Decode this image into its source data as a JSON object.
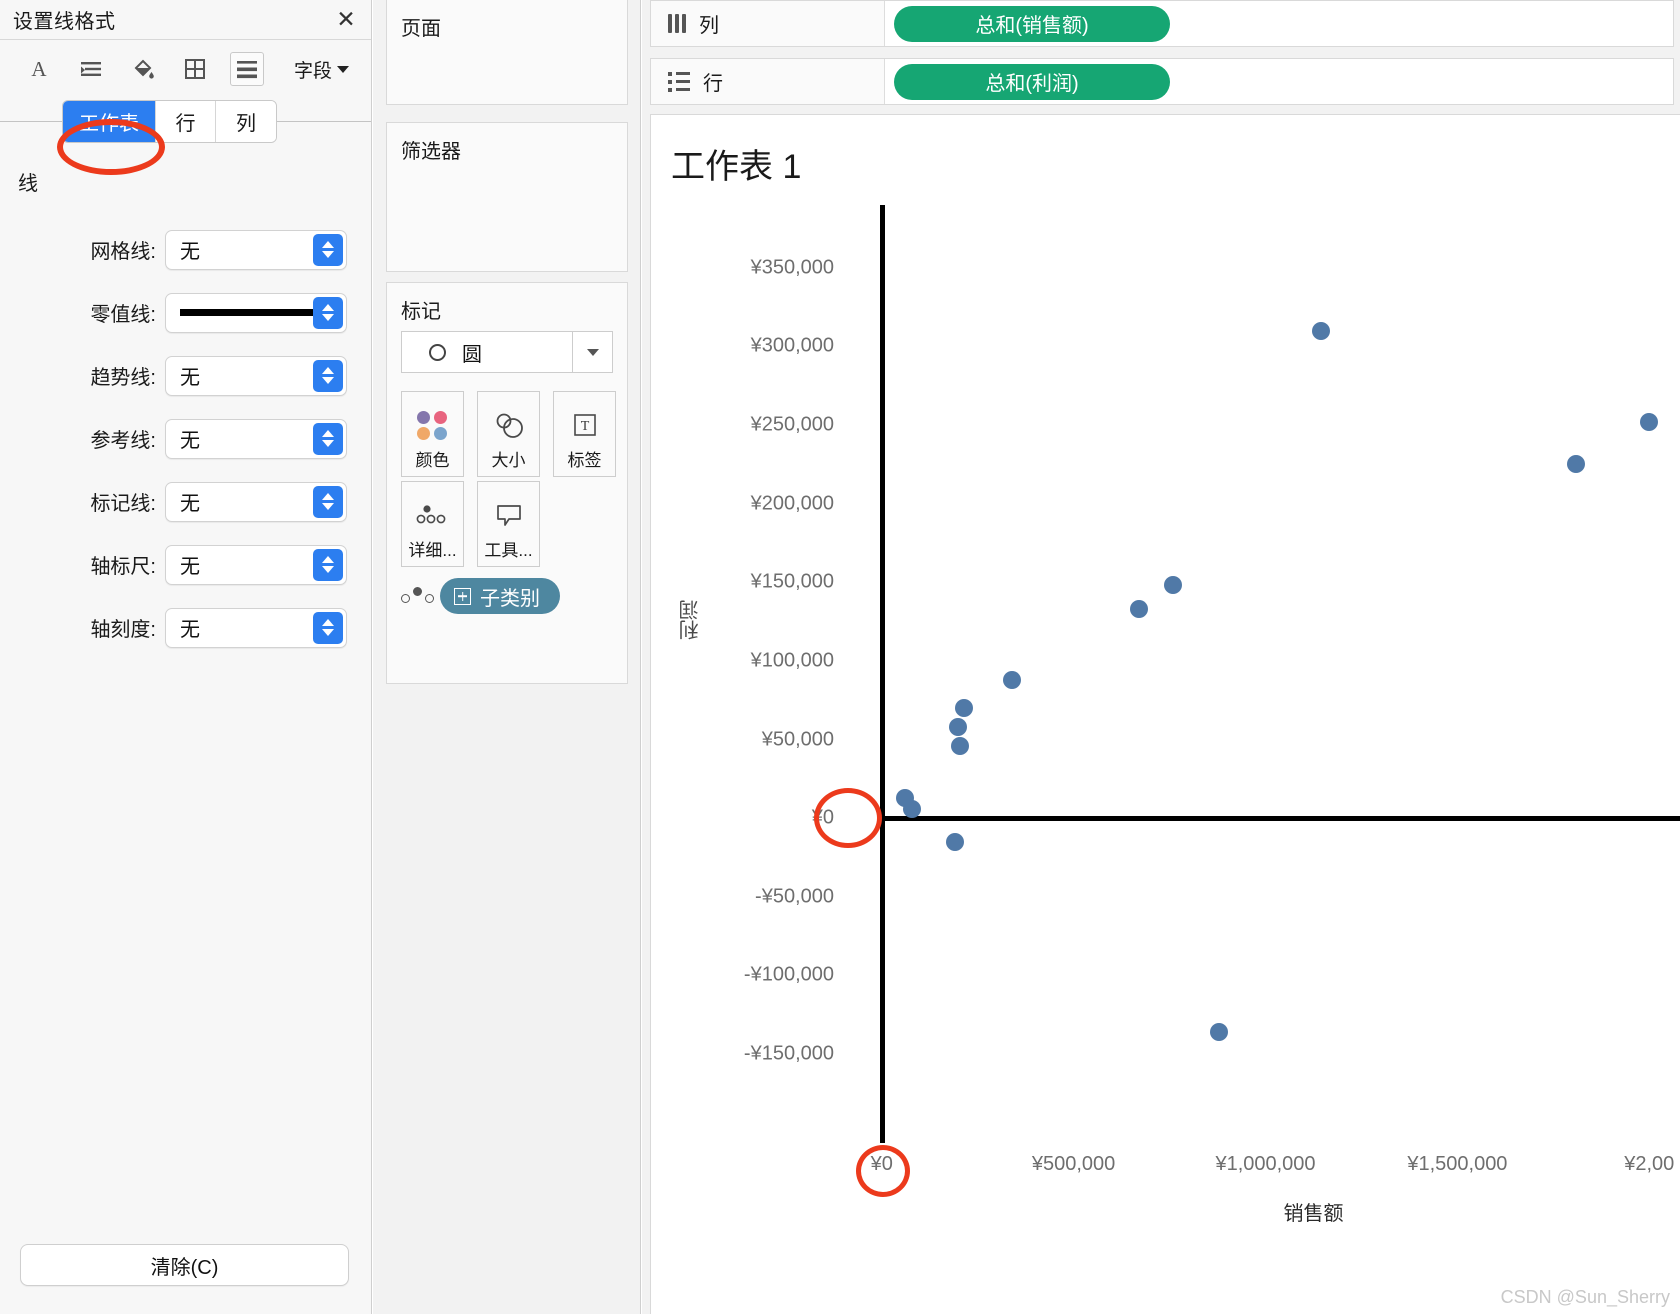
{
  "format_panel": {
    "title": "设置线格式",
    "close_icon": "close-icon",
    "toolbar": [
      {
        "icon": "font-icon",
        "glyph": "A",
        "selected": false
      },
      {
        "icon": "align-icon",
        "glyph": "",
        "selected": false
      },
      {
        "icon": "shading-icon",
        "glyph": "",
        "selected": false
      },
      {
        "icon": "borders-icon",
        "glyph": "",
        "selected": false
      },
      {
        "icon": "lines-icon",
        "glyph": "",
        "selected": true
      }
    ],
    "fields_label": "字段",
    "tabs": [
      {
        "label": "工作表",
        "active": true
      },
      {
        "label": "行",
        "active": false
      },
      {
        "label": "列",
        "active": false
      }
    ],
    "section_title": "线",
    "rows": [
      {
        "label": "网格线:",
        "value": "无",
        "type": "text"
      },
      {
        "label": "零值线:",
        "value": "",
        "type": "line"
      },
      {
        "label": "趋势线:",
        "value": "无",
        "type": "text"
      },
      {
        "label": "参考线:",
        "value": "无",
        "type": "text"
      },
      {
        "label": "标记线:",
        "value": "无",
        "type": "text"
      },
      {
        "label": "轴标尺:",
        "value": "无",
        "type": "text"
      },
      {
        "label": "轴刻度:",
        "value": "无",
        "type": "text"
      }
    ],
    "clear_label": "清除(C)"
  },
  "cards": {
    "pages": "页面",
    "filters": "筛选器",
    "marks": "标记",
    "mark_type": "圆",
    "tiles": [
      {
        "label": "颜色",
        "icon": "color-palette-icon"
      },
      {
        "label": "大小",
        "icon": "size-circles-icon"
      },
      {
        "label": "标签",
        "icon": "text-label-icon"
      },
      {
        "label": "详细...",
        "icon": "detail-dots-icon"
      },
      {
        "label": "工具...",
        "icon": "tooltip-icon"
      }
    ],
    "detail_pill": "子类别"
  },
  "shelves": {
    "columns_label": "列",
    "columns_pill": "总和(销售额)",
    "rows_label": "行",
    "rows_pill": "总和(利润)"
  },
  "view": {
    "title": "工作表 1",
    "watermark": "CSDN @Sun_Sherry"
  },
  "colors": {
    "accent_blue": "#2c7ef0",
    "pill_green": "#16a673",
    "pill_teal": "#4e87a0",
    "mark_blue": "#5079a7",
    "annotation_red": "#ec3a1c"
  },
  "chart_data": {
    "type": "scatter",
    "title": "工作表 1",
    "xlabel": "销售额",
    "ylabel": "利润",
    "xticks": [
      "¥0",
      "¥500,000",
      "¥1,000,000",
      "¥1,500,000",
      "¥2,00"
    ],
    "xtick_values": [
      0,
      500000,
      1000000,
      1500000,
      2000000
    ],
    "yticks": [
      "¥350,000",
      "¥300,000",
      "¥250,000",
      "¥200,000",
      "¥150,000",
      "¥100,000",
      "¥50,000",
      "¥0",
      "-¥50,000",
      "-¥100,000",
      "-¥150,000"
    ],
    "ytick_values": [
      350000,
      300000,
      250000,
      200000,
      150000,
      100000,
      50000,
      0,
      -50000,
      -100000,
      -150000
    ],
    "xlim": [
      -80000,
      2080000
    ],
    "ylim": [
      -185000,
      390000
    ],
    "grid": false,
    "legend": null,
    "zero_lines": {
      "x": 0,
      "y": 0
    },
    "series": [
      {
        "name": "子类别",
        "color": "#5079a7",
        "points": [
          {
            "x": 60000,
            "y": 13000
          },
          {
            "x": 80000,
            "y": 6000
          },
          {
            "x": 190000,
            "y": -15000
          },
          {
            "x": 205000,
            "y": 46000
          },
          {
            "x": 200000,
            "y": 58000
          },
          {
            "x": 215000,
            "y": 70000
          },
          {
            "x": 340000,
            "y": 88000
          },
          {
            "x": 670000,
            "y": 133000
          },
          {
            "x": 760000,
            "y": 148000
          },
          {
            "x": 880000,
            "y": -136000
          },
          {
            "x": 1145000,
            "y": 310000
          },
          {
            "x": 1810000,
            "y": 225000
          },
          {
            "x": 2000000,
            "y": 252000
          }
        ]
      }
    ]
  }
}
